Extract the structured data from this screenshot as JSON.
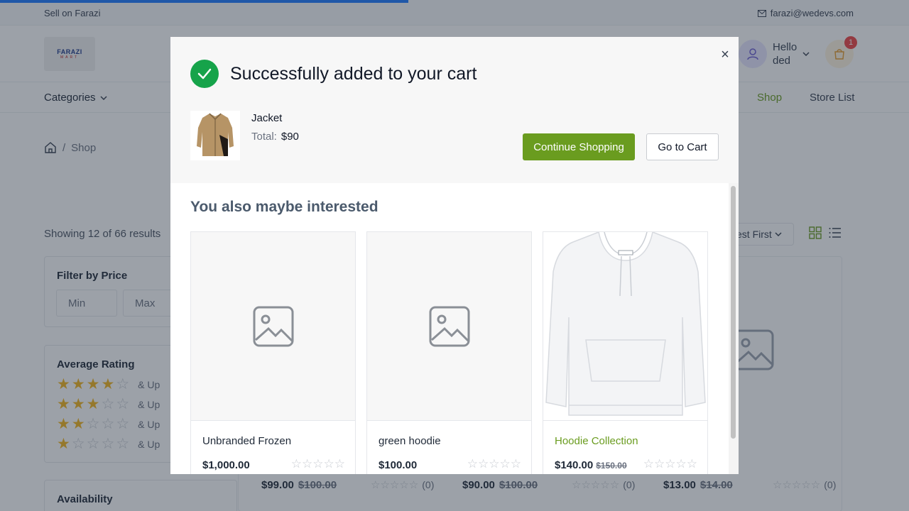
{
  "topbar": {
    "sell_label": "Sell on Farazi",
    "email": "farazi@wedevs.com"
  },
  "header": {
    "logo_text": "FARAZI",
    "logo_sub": "MART",
    "greeting_line1": "Hello",
    "greeting_line2": "ded",
    "cart_count": "1"
  },
  "nav": {
    "categories_label": "Categories",
    "shop_label": "Shop",
    "store_list_label": "Store List"
  },
  "breadcrumb": {
    "current": "Shop",
    "separator": "/"
  },
  "listing": {
    "showing_text": "Showing 12 of 66 results",
    "sort_label": "est First"
  },
  "filters": {
    "price_title": "Filter by Price",
    "min_placeholder": "Min",
    "max_placeholder": "Max",
    "rating_title": "Average Rating",
    "and_up": "& Up",
    "availability_title": "Availability"
  },
  "background_products": [
    {
      "price": "$99.00",
      "old_price": "$100.00",
      "count": "(0)"
    },
    {
      "price": "$90.00",
      "old_price": "$100.00",
      "count": "(0)"
    },
    {
      "price": "$13.00",
      "old_price": "$14.00",
      "count": "(0)"
    }
  ],
  "modal": {
    "message": "Successfully added to your cart",
    "product_name": "Jacket",
    "total_label": "Total:",
    "total_value": "$90",
    "continue_label": "Continue Shopping",
    "go_to_cart_label": "Go to Cart",
    "close_symbol": "×",
    "interested_title": "You also maybe interested",
    "products": [
      {
        "name": "Unbranded Frozen",
        "price": "$1,000.00",
        "old_price": "",
        "rating": 0,
        "image": "placeholder-image-icon"
      },
      {
        "name": "green hoodie",
        "price": "$100.00",
        "old_price": "",
        "rating": 0,
        "image": "placeholder-image-icon"
      },
      {
        "name": "Hoodie Collection",
        "price": "$140.00",
        "old_price": "$150.00",
        "rating": 0,
        "image": "white-hoodie"
      }
    ]
  },
  "colors": {
    "accent_green": "#6a9c1f",
    "success_green": "#16a34a",
    "progress_blue": "#1e7bff",
    "badge_red": "#ef4444",
    "star_gold": "#f2b51e"
  }
}
